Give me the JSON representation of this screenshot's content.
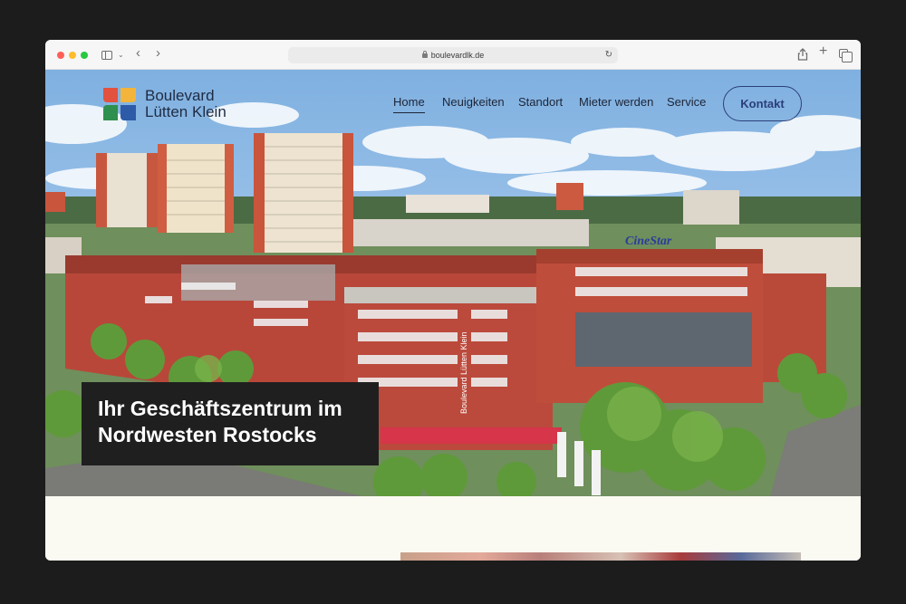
{
  "browser": {
    "url": "boulevardlk.de"
  },
  "logo": {
    "line1": "Boulevard",
    "line2": "Lütten Klein",
    "colors": [
      "#e2523e",
      "#f2b43a",
      "#2f8f4e",
      "#2d5ba8"
    ]
  },
  "nav": {
    "items": [
      {
        "label": "Home",
        "active": true
      },
      {
        "label": "Neuigkeiten",
        "active": false
      },
      {
        "label": "Standort",
        "active": false
      },
      {
        "label": "Mieter werden",
        "active": false
      },
      {
        "label": "Service",
        "active": false
      }
    ],
    "cta": "Kontakt"
  },
  "hero": {
    "headline_line1": "Ihr Geschäftszentrum im",
    "headline_line2": "Nordwesten Rostocks",
    "building_sign": "Boulevard Lütten Klein",
    "rooftop_sign": "CineStar"
  },
  "colors": {
    "page_background": "#fbfaf2",
    "accent": "#2b3f7a",
    "headline_box": "#1f1f1f",
    "brick": "#b8473a"
  }
}
